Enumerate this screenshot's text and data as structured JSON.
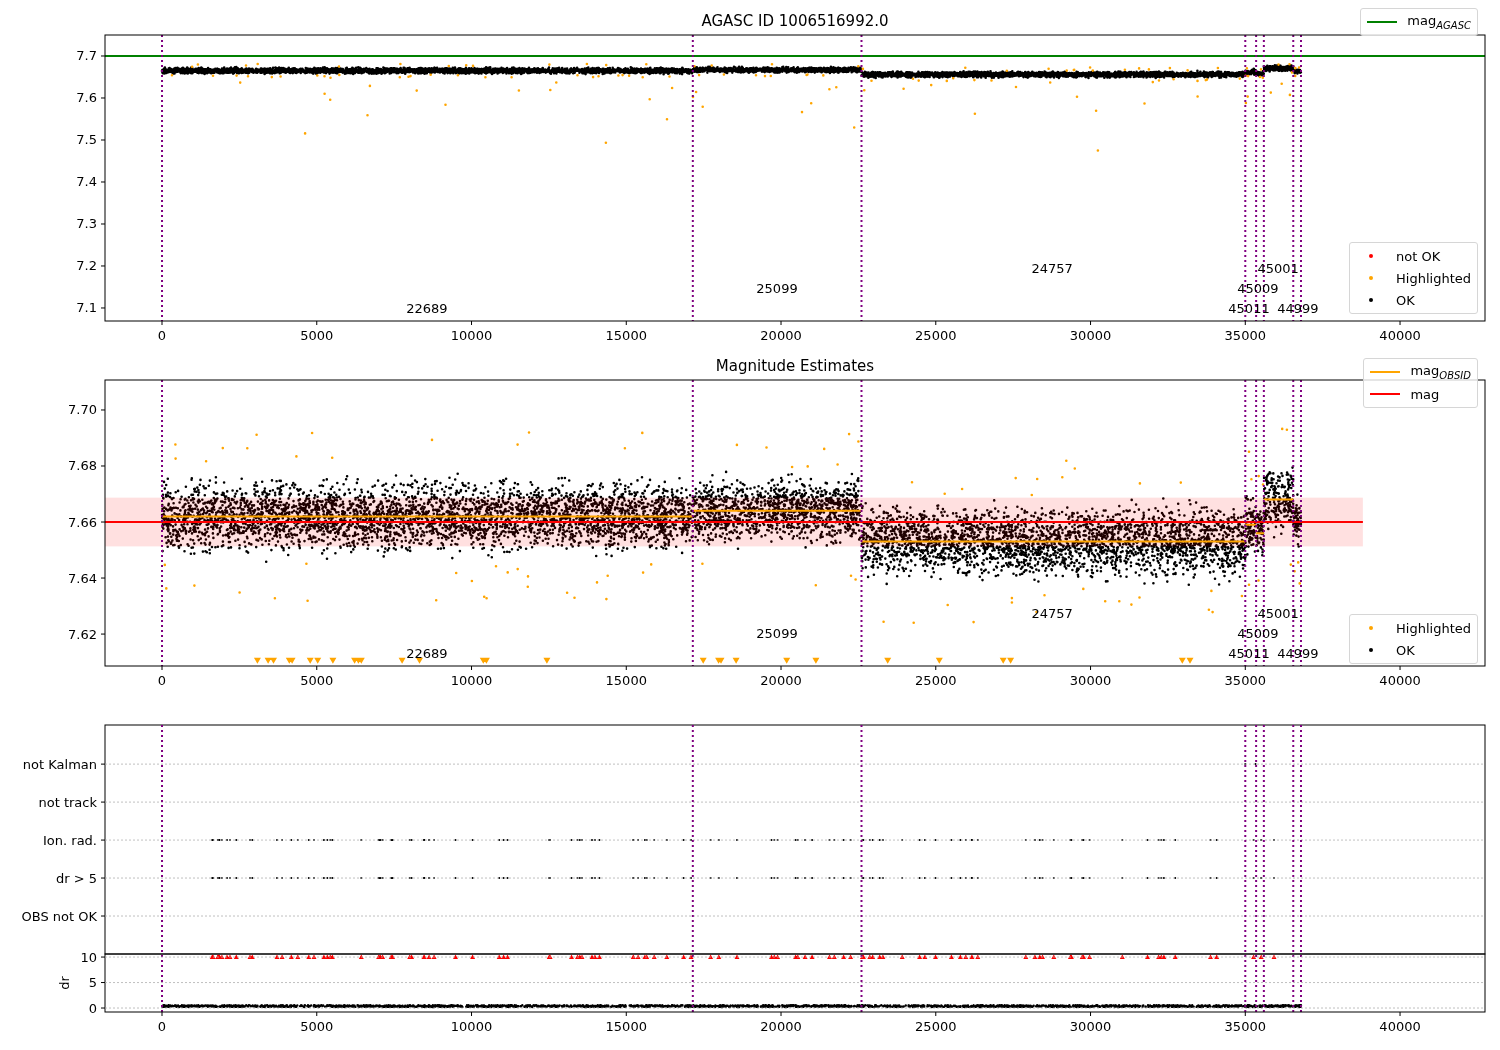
{
  "panels": [
    {
      "title": "AGASC ID 1006516992.0",
      "legends": [
        {
          "entries": [
            {
              "label": "not OK",
              "color": "#ff0000"
            },
            {
              "label": "Highlighted",
              "color": "#ffa500"
            },
            {
              "label": "OK",
              "color": "#000000"
            }
          ]
        }
      ],
      "chart_data": {
        "type": "line",
        "xlim": [
          -1842,
          42745
        ],
        "ylim": [
          7.069,
          7.75
        ],
        "xticks": [
          0,
          5000,
          10000,
          15000,
          20000,
          25000,
          30000,
          35000,
          40000
        ],
        "yticks": [
          7.1,
          7.2,
          7.3,
          7.4,
          7.5,
          7.6,
          7.7
        ],
        "x": [
          -1842,
          42745
        ],
        "series": [
          {
            "name": "mag$_{AGASC}$",
            "color": "#008000",
            "values": [
              7.7,
              7.7
            ]
          }
        ],
        "ref_lines": [
          {
            "axis": "x",
            "value": 0
          },
          {
            "axis": "x",
            "value": 17150
          },
          {
            "axis": "x",
            "value": 22600
          },
          {
            "axis": "x",
            "value": 35000
          },
          {
            "axis": "x",
            "value": 35350
          },
          {
            "axis": "x",
            "value": 35600
          },
          {
            "axis": "x",
            "value": 36550
          },
          {
            "axis": "x",
            "value": 36800
          }
        ],
        "annotations": [
          "22689",
          "25099",
          "24757",
          "45001",
          "45009",
          "45011",
          "44999"
        ]
      }
    },
    {
      "title": "Magnitude Estimates",
      "legends": [
        {
          "entries": [
            {
              "label": "Highlighted",
              "color": "#ffa500"
            },
            {
              "label": "OK",
              "color": "#000000"
            }
          ]
        }
      ],
      "chart_data": {
        "type": "line",
        "xlim": [
          -1842,
          42745
        ],
        "ylim": [
          7.6086,
          7.7107
        ],
        "xticks": [
          0,
          5000,
          10000,
          15000,
          20000,
          25000,
          30000,
          35000,
          40000
        ],
        "yticks": [
          {
            "value": 7.62,
            "label": "7.62"
          },
          {
            "value": 7.64,
            "label": "7.64"
          },
          {
            "value": 7.66,
            "label": "7.66"
          },
          {
            "value": 7.68,
            "label": "7.68"
          },
          {
            "value": 7.7,
            "label": "7.70"
          }
        ],
        "x": [
          -1842,
          0,
          17150,
          17150,
          17150,
          22600,
          22600,
          22600,
          35000,
          35000,
          35000,
          35350,
          35350,
          35350,
          35600,
          35600,
          35600,
          36550,
          36550,
          36550,
          36800,
          38800
        ],
        "series": [
          {
            "name": "mag$_{OBSID}$",
            "color": "#ffa500",
            "values": [
              null,
              7.662,
              7.662,
              null,
              7.664,
              7.664,
              null,
              7.653,
              7.653,
              null,
              7.659,
              7.659,
              null,
              7.656,
              7.656,
              null,
              7.668,
              7.668,
              null,
              7.66,
              7.66,
              null
            ]
          },
          {
            "name": "mag",
            "color": "#ff0000",
            "values": [
              7.66,
              7.66,
              7.66,
              7.66,
              7.66,
              7.66,
              7.66,
              7.66,
              7.66,
              7.66,
              7.66,
              7.66,
              7.66,
              7.66,
              7.66,
              7.66,
              7.66,
              7.66,
              7.66,
              7.66,
              7.66,
              7.66
            ]
          }
        ],
        "bands": [
          {
            "axis": "y",
            "from": 7.6513,
            "to": 7.6687,
            "color": "#ff0000"
          }
        ],
        "ref_lines": [
          {
            "axis": "x",
            "value": 0
          },
          {
            "axis": "x",
            "value": 17150
          },
          {
            "axis": "x",
            "value": 22600
          },
          {
            "axis": "x",
            "value": 35000
          },
          {
            "axis": "x",
            "value": 35350
          },
          {
            "axis": "x",
            "value": 35600
          },
          {
            "axis": "x",
            "value": 36550
          },
          {
            "axis": "x",
            "value": 36800
          }
        ],
        "annotations": [
          "22689",
          "25099",
          "24757",
          "45001",
          "45009",
          "45011",
          "44999"
        ]
      }
    },
    {
      "flag_rows": {
        "grid": true,
        "labels": [
          "not Kalman",
          "not track",
          "Ion. rad.",
          "dr > 5",
          "OBS not OK"
        ]
      },
      "dr_subplot": {
        "chart_data": {
          "type": "scatter",
          "grid": true,
          "ylabel": "dr",
          "xlim": [
            -1842,
            42745
          ],
          "ylim": [
            -0.78,
            10.6
          ],
          "xticks": [
            0,
            5000,
            10000,
            15000,
            20000,
            25000,
            30000,
            35000,
            40000
          ],
          "yticks": [
            0,
            5,
            10
          ],
          "ref_lines": [
            {
              "axis": "x",
              "value": 0
            },
            {
              "axis": "x",
              "value": 17150
            },
            {
              "axis": "x",
              "value": 22600
            },
            {
              "axis": "x",
              "value": 35000
            },
            {
              "axis": "x",
              "value": 35350
            },
            {
              "axis": "x",
              "value": 35600
            },
            {
              "axis": "x",
              "value": 36550
            },
            {
              "axis": "x",
              "value": 36800
            }
          ]
        }
      }
    }
  ]
}
